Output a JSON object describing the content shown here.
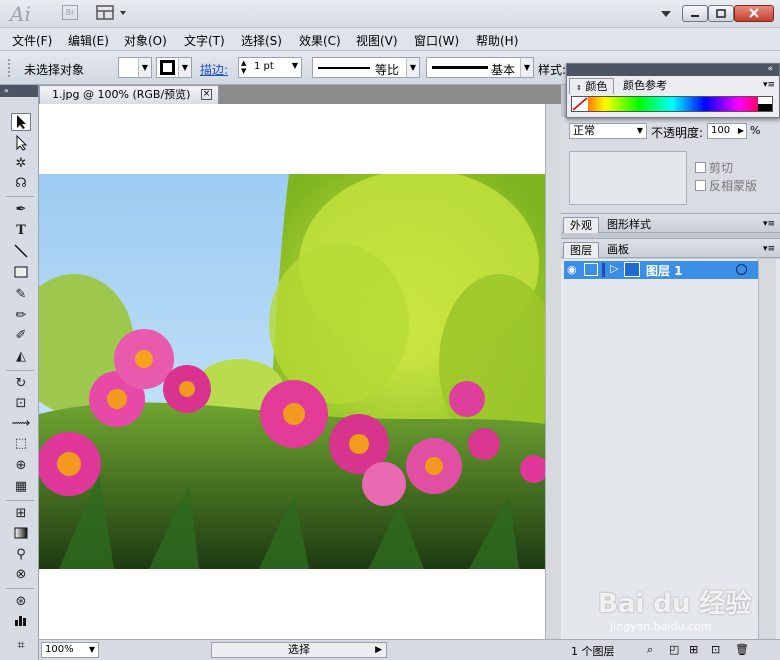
{
  "titlebar": {
    "app_logo": "Ai",
    "bridge_badge": "Br",
    "workspace_icon": "arrange-documents-icon",
    "buttons": [
      "minimize",
      "restore",
      "close"
    ]
  },
  "menu": [
    "文件(F)",
    "编辑(E)",
    "对象(O)",
    "文字(T)",
    "选择(S)",
    "效果(C)",
    "视图(V)",
    "窗口(W)",
    "帮助(H)"
  ],
  "control": {
    "selection_status": "未选择对象",
    "stroke_label": "描边:",
    "stroke_weight": "1 pt",
    "profile_label": "等比",
    "brush_label": "基本",
    "style_label": "样式:"
  },
  "document": {
    "tab_title": "1.jpg @ 100% (RGB/预览)",
    "zoom": "100%",
    "status_select": "选择"
  },
  "color_panel": {
    "tabs": [
      "颜色",
      "颜色参考"
    ]
  },
  "transparency": {
    "blend_mode": "正常",
    "opacity_label": "不透明度:",
    "opacity_value": "100",
    "opacity_unit": "%",
    "clip_label": "剪切",
    "invert_mask_label": "反相蒙版"
  },
  "appearance_tabs": [
    "外观",
    "图形样式"
  ],
  "layers": {
    "tabs": [
      "图层",
      "画板"
    ],
    "layer_name": "图层 1",
    "footer_count": "1 个图层"
  },
  "watermark": {
    "text": "Bai du 经验",
    "sub": "jingyan.baidu.com"
  },
  "colors": {
    "selection_blue": "#3a8ee6",
    "panel_header": "#4d5564",
    "sky": "#a9d3f3",
    "flower": "#e0389a"
  }
}
